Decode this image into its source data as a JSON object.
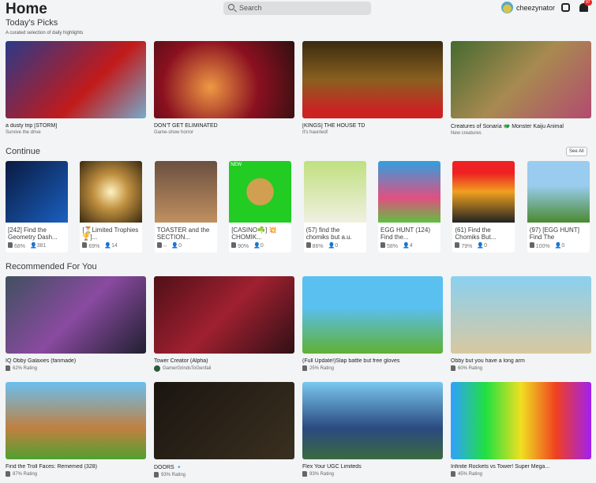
{
  "header": {
    "title": "Home",
    "search_placeholder": "Search",
    "username": "cheezynator",
    "notifications": "97"
  },
  "todays_picks": {
    "title": "Today's Picks",
    "subtitle": "A curated selection of daily highlights",
    "items": [
      {
        "title": "a dusty trip [STORM]",
        "sub": "Survive the drive",
        "bg": "linear-gradient(135deg,#2a3a8a,#c21a1a 60%,#7ac)"
      },
      {
        "title": "DON'T GET ELIMINATED",
        "sub": "Game-show horror",
        "bg": "radial-gradient(circle at 40% 60%,#e94,#8b1020 50%,#301010)"
      },
      {
        "title": "[KINGS] THE HOUSE TD",
        "sub": "It's haunted!",
        "bg": "linear-gradient(180deg,#3a2a10,#8a6020 50%,#c22 90%)"
      },
      {
        "title": "Creatures of Sonaria 🐲 Monster Kaiju Animal",
        "sub": "New creatures",
        "bg": "linear-gradient(135deg,#456a30,#a88a50 50%,#b34a70)"
      }
    ]
  },
  "continue": {
    "title": "Continue",
    "see_all": "See All",
    "items": [
      {
        "title": "[242] Find the Geometry Dash...",
        "rating": "68%",
        "players": "381",
        "bg": "linear-gradient(135deg,#0a1a40,#1a60c0)"
      },
      {
        "title": "[⏳Limited Trophies🏆]...",
        "rating": "69%",
        "players": "14",
        "bg": "radial-gradient(circle,#fff3c0,#c09040 40%,#3a2a10)"
      },
      {
        "title": "TOASTER and the SECTION...",
        "rating": "--",
        "players": "0",
        "bg": "linear-gradient(180deg,#6a5040,#c09060)"
      },
      {
        "title": "[CASINO☘️] 💥 CHOMIK...",
        "rating": "90%",
        "players": "0",
        "bg": "radial-gradient(circle,#d0a050 30%,#2c2 32%)",
        "tag": "NEW"
      },
      {
        "title": "(57) find the chomiks but a.u.",
        "rating": "86%",
        "players": "0",
        "bg": "linear-gradient(180deg,#c0e080,#f0f0e0)"
      },
      {
        "title": "EGG HUNT (124) Find the...",
        "rating": "58%",
        "players": "4",
        "bg": "linear-gradient(180deg,#30a0e0,#e05080 60%,#60c040)"
      },
      {
        "title": "(61) Find the Chomiks But...",
        "rating": "79%",
        "players": "0",
        "bg": "linear-gradient(180deg,#e22 20%,#f0a020 50%,#222)"
      },
      {
        "title": "(97) [EGG HUNT] Find The",
        "rating": "100%",
        "players": "0",
        "bg": "linear-gradient(180deg,#9ce 40%,#4a8a30)"
      }
    ]
  },
  "recommended": {
    "title": "Recommended For You",
    "items": [
      {
        "title": "IQ Obby Galaxies (fanmade)",
        "rating": "62% Rating",
        "bg": "linear-gradient(135deg,#405060,#8a4aa0 50%,#202030)"
      },
      {
        "title": "Tower Creator (Alpha)",
        "creator": "GamerGrindsToGenfail",
        "bg": "linear-gradient(135deg,#501018,#a02030 50%,#301015)"
      },
      {
        "title": "(Full Update!)Slap battle but free gloves",
        "rating": "25% Rating",
        "bg": "linear-gradient(180deg,#5ac0f0 40%,#60b030)"
      },
      {
        "title": "Obby but you have a long arm",
        "rating": "60% Rating",
        "bg": "linear-gradient(180deg,#8ad0f0,#d8c8a0)"
      },
      {
        "title": "Find the Troll Faces: Rememed (328)",
        "rating": "87% Rating",
        "bg": "linear-gradient(180deg,#6ac0f0,#c08040 60%,#50a030)"
      },
      {
        "title": "DOORS 🔹",
        "rating": "93% Rating",
        "bg": "linear-gradient(135deg,#1a1510,#3a3020)"
      },
      {
        "title": "Flex Your UGC Limiteds",
        "rating": "93% Rating",
        "bg": "linear-gradient(180deg,#7ac8f0,#2a4a80 60%,#3a6a40)"
      },
      {
        "title": "Infinite Rockets vs Tower! Super Mega...",
        "rating": "45% Rating",
        "bg": "linear-gradient(90deg,#30a0ff,#20e040,#f0e020,#f04020,#a020f0)"
      }
    ]
  }
}
